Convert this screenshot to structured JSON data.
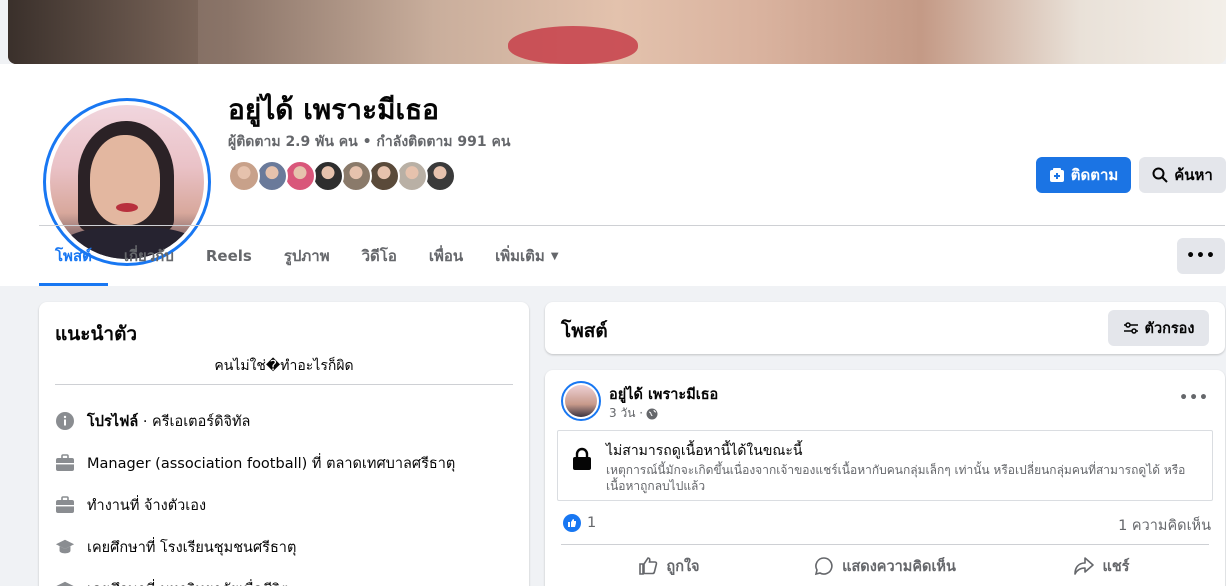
{
  "profile": {
    "name": "อยู่ได้ เพราะมีเธอ",
    "stats": "ผู้ติดตาม 2.9 พัน คน • กำลังติดตาม 991 คน",
    "follow_label": "ติดตาม",
    "search_label": "ค้นหา"
  },
  "friend_avatar_colors": [
    "#c8a18a",
    "#6a7a9a",
    "#d9567a",
    "#2e2e2e",
    "#8a7a6a",
    "#5a4a3a",
    "#b9b0a5",
    "#3a3a3a"
  ],
  "tabs": [
    {
      "label": "โพสต์",
      "active": true
    },
    {
      "label": "เกี่ยวกับ"
    },
    {
      "label": "Reels"
    },
    {
      "label": "รูปภาพ"
    },
    {
      "label": "วิดีโอ"
    },
    {
      "label": "เพื่อน"
    },
    {
      "label": "เพิ่มเติม"
    }
  ],
  "more_dots": "•••",
  "intro": {
    "title": "แนะนำตัว",
    "bio": "คนไม่ใช่�ทำอะไรก็ผิด",
    "items": [
      {
        "icon": "info-icon",
        "bold": "โปรไฟล์",
        "text": " · ครีเอเตอร์ดิจิทัล"
      },
      {
        "icon": "briefcase-icon",
        "bold": "",
        "text": "Manager (association football) ที่ ตลาดเทศบาลศรีธาตุ"
      },
      {
        "icon": "briefcase-icon",
        "bold": "",
        "text": "ทำงานที่ จ้างตัวเอง"
      },
      {
        "icon": "graduation-cap-icon",
        "bold": "",
        "text": "เคยศึกษาที่ โรงเรียนชุมชนศรีธาตุ"
      },
      {
        "icon": "graduation-cap-icon",
        "bold": "",
        "text": "เคยศึกษาที่ มหาวิทยาลัยเพื่อชีวิต"
      }
    ]
  },
  "posts": {
    "title": "โพสต์",
    "filter_label": "ตัวกรอง"
  },
  "post": {
    "author": "อยู่ได้ เพราะมีเธอ",
    "time": "3 วัน ·",
    "unavailable_title": "ไม่สามารถดูเนื้อหานี้ได้ในขณะนี้",
    "unavailable_desc": "เหตุการณ์นี้มักจะเกิดขึ้นเนื่องจากเจ้าของแชร์เนื้อหากับคนกลุ่มเล็กๆ เท่านั้น หรือเปลี่ยนกลุ่มคนที่สามารถดูได้ หรือเนื้อหาถูกลบไปแล้ว",
    "like_count": "1",
    "comments": "1 ความคิดเห็น",
    "like_label": "ถูกใจ",
    "comment_label": "แสดงความคิดเห็น",
    "share_label": "แชร์"
  },
  "colors": {
    "accent": "#1877f2",
    "bg": "#f0f2f5"
  }
}
